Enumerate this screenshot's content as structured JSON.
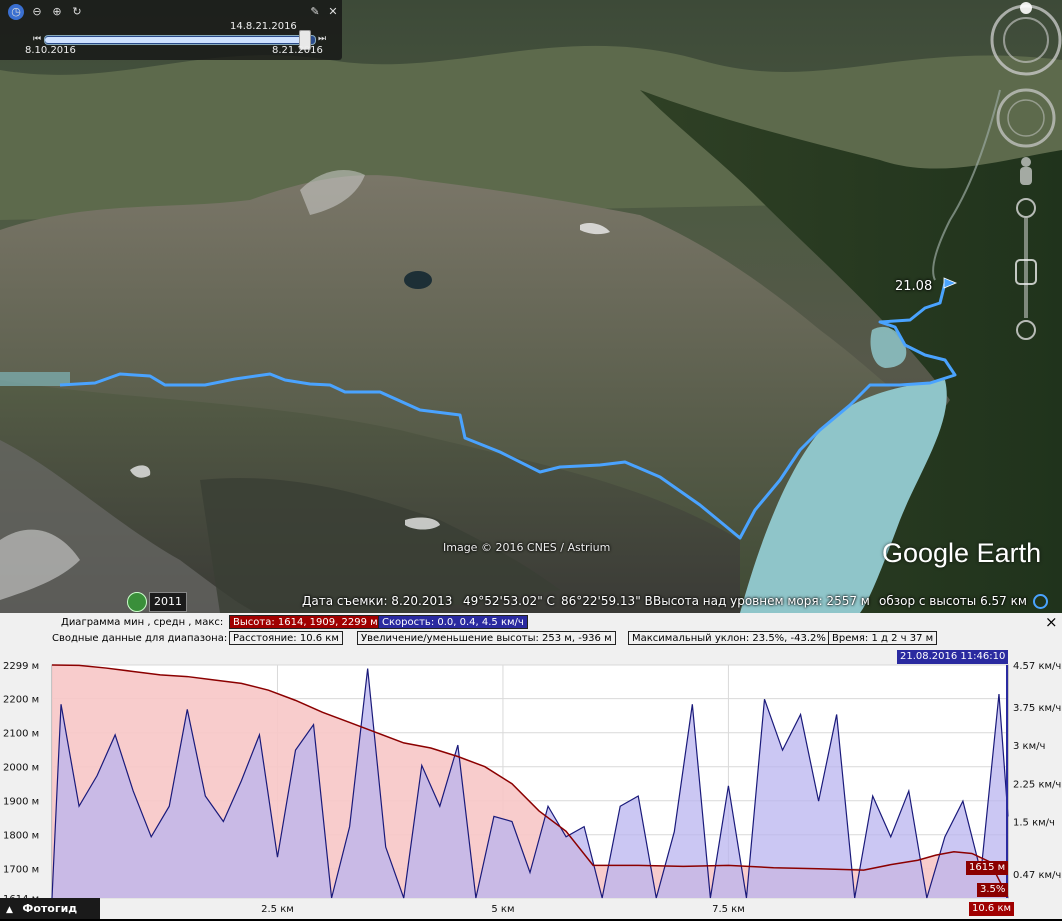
{
  "time_slider": {
    "current_label": "14.8.21.2016",
    "start_label": "8.10.2016",
    "end_label": "8.21.2016",
    "position": 0.97
  },
  "map": {
    "track_label": "21.08",
    "imagery_credit": "Image © 2016 CNES / Astrium",
    "brand": "Google Earth",
    "historical_year": "2011",
    "colors": {
      "track": "#4aa3ff",
      "lake": "#8fc5c9"
    }
  },
  "status": {
    "imagery_date": "Дата съемки: 8.20.2013",
    "latitude": "49°52'53.02\" С",
    "longitude": "86°22'59.13\" В",
    "elevation": "Высота над уровнем моря:  2557 м",
    "eye_altitude": "обзор с высоты   6.57 км"
  },
  "profile": {
    "row1_label": "Диаграмма  мин , средн , макс:",
    "elevation_box": "Высота: 1614, 1909, 2299 м",
    "speed_box": "Скорость: 0.0, 0.4, 4.5 км/ч",
    "row2_label": "Сводные данные для диапазона:",
    "distance_box": "Расстояние: 10.6 км",
    "gain_box": "Увеличение/уменьшение высоты: 253 м, -936 м",
    "slope_box": "Максимальный уклон: 23.5%, -43.2%",
    "time_box": "Время: 1 д 2 ч 37 м",
    "timestamp": "21.08.2016 11:46:10",
    "current_elevation": "1615 м",
    "current_slope": "3.5%",
    "current_distance": "10.6 км",
    "photo_guide": "Фотогид",
    "close": "×",
    "colors": {
      "elevation_line": "#8b0000",
      "elevation_fill": "#f7c6c6",
      "speed_line": "#1a1a7a",
      "speed_fill": "#b9b4ef"
    }
  },
  "chart_data": {
    "type": "area",
    "xlabel": "",
    "ylabel": "",
    "x_ticks": [
      "2.5 км",
      "5 км",
      "7.5 км"
    ],
    "x_tick_values": [
      2.5,
      5,
      7.5
    ],
    "xlim": [
      0,
      10.6
    ],
    "left_ticks": [
      "2299 м",
      "2200 м",
      "2100 м",
      "2000 м",
      "1900 м",
      "1800 м",
      "1700 м",
      "1614 м"
    ],
    "left_tick_values": [
      2299,
      2200,
      2100,
      2000,
      1900,
      1800,
      1700,
      1614
    ],
    "ylim_elevation": [
      1614,
      2299
    ],
    "right_ticks": [
      "4.57 км/ч",
      "3.75 км/ч",
      "3 км/ч",
      "2.25 км/ч",
      "1.5 км/ч",
      "0.47 км/ч"
    ],
    "right_tick_values": [
      4.57,
      3.75,
      3,
      2.25,
      1.5,
      0.47
    ],
    "ylim_speed": [
      0,
      4.57
    ],
    "series": [
      {
        "name": "Высота",
        "x": [
          0,
          0.3,
          0.6,
          0.9,
          1.2,
          1.5,
          1.8,
          2.1,
          2.4,
          2.7,
          3.0,
          3.3,
          3.6,
          3.9,
          4.2,
          4.5,
          4.8,
          5.1,
          5.4,
          5.7,
          6.0,
          6.5,
          7.0,
          7.5,
          8.0,
          8.5,
          9.0,
          9.3,
          9.6,
          9.8,
          10.0,
          10.2,
          10.4,
          10.6
        ],
        "values": [
          2299,
          2298,
          2290,
          2280,
          2270,
          2265,
          2255,
          2245,
          2225,
          2195,
          2160,
          2130,
          2100,
          2070,
          2055,
          2030,
          2000,
          1950,
          1870,
          1810,
          1710,
          1710,
          1707,
          1710,
          1703,
          1700,
          1696,
          1712,
          1725,
          1740,
          1750,
          1745,
          1720,
          1615
        ]
      },
      {
        "name": "Скорость",
        "x": [
          0,
          0.1,
          0.3,
          0.5,
          0.7,
          0.9,
          1.1,
          1.3,
          1.5,
          1.7,
          1.9,
          2.1,
          2.3,
          2.5,
          2.7,
          2.9,
          3.1,
          3.3,
          3.5,
          3.7,
          3.9,
          4.1,
          4.3,
          4.5,
          4.7,
          4.9,
          5.1,
          5.3,
          5.5,
          5.7,
          5.9,
          6.1,
          6.3,
          6.5,
          6.7,
          6.9,
          7.1,
          7.3,
          7.5,
          7.7,
          7.9,
          8.1,
          8.3,
          8.5,
          8.7,
          8.9,
          9.1,
          9.3,
          9.5,
          9.7,
          9.9,
          10.1,
          10.3,
          10.5,
          10.6
        ],
        "values": [
          0,
          3.8,
          1.8,
          2.4,
          3.2,
          2.1,
          1.2,
          1.8,
          3.7,
          2.0,
          1.5,
          2.3,
          3.2,
          0.8,
          2.9,
          3.4,
          0.0,
          1.4,
          4.5,
          1.0,
          0.0,
          2.6,
          1.8,
          3.0,
          0.0,
          1.6,
          1.5,
          0.5,
          1.8,
          1.2,
          1.4,
          0.0,
          1.8,
          2.0,
          0.0,
          1.3,
          3.8,
          0.0,
          2.2,
          0.0,
          3.9,
          2.9,
          3.6,
          1.9,
          3.6,
          0.0,
          2.0,
          1.2,
          2.1,
          0.0,
          1.2,
          1.9,
          0.5,
          4.0,
          1.6
        ]
      }
    ]
  }
}
